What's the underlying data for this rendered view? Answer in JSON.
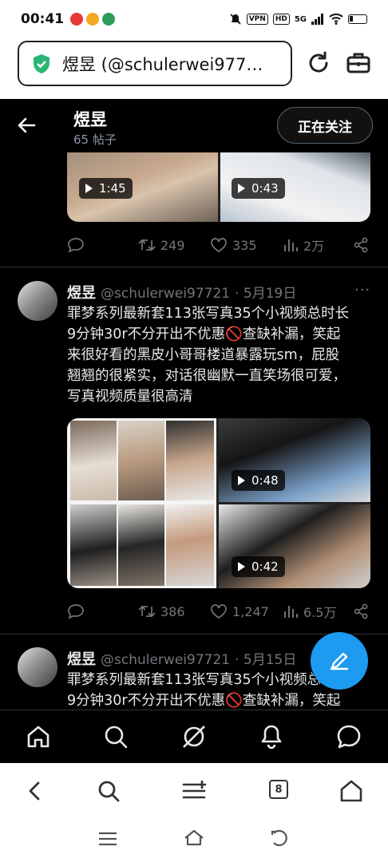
{
  "status_bar": {
    "time": "00:41",
    "net_labels": [
      "VPN",
      "HD",
      "5G"
    ]
  },
  "browser": {
    "url_text": "煜昱 (@schulerwei977…",
    "tab_count": "8"
  },
  "profile": {
    "name": "煜昱",
    "posts": "65 帖子",
    "follow_label": "正在关注"
  },
  "post0": {
    "videos": [
      "1:45",
      "0:43"
    ],
    "stats": {
      "retweets": "249",
      "likes": "335",
      "views": "2万"
    }
  },
  "post1": {
    "name": "煜昱",
    "handle": "@schulerwei97721",
    "date": "· 5月19日",
    "more": "···",
    "text_lines": [
      "罪梦系列最新套113张写真35个小视频总时长",
      "9分钟30r不分开出不优惠🚫查缺补漏，笑起",
      "来很好看的黑皮小哥哥楼道暴露玩sm，屁股",
      "翘翘的很紧实，对话很幽默一直笑场很可爱，",
      "写真视频质量很高清"
    ],
    "videos": [
      "0:48",
      "0:42"
    ],
    "stats": {
      "retweets": "386",
      "likes": "1,247",
      "views": "6.5万"
    }
  },
  "post2": {
    "name": "煜昱",
    "handle": "@schulerwei97721",
    "date": "· 5月15日",
    "text_lines": [
      "罪梦系列最新套113张写真35个小视频总时长",
      "9分钟30r不分开出不优惠🚫查缺补漏，笑起"
    ]
  },
  "colors": {
    "accent": "#1d9bf0",
    "background": "#000000",
    "muted": "#71767b",
    "verified": "#2bb673"
  },
  "icons": {
    "tabs": [
      "home-icon",
      "search-icon",
      "grok-icon",
      "notifications-icon",
      "messages-icon"
    ],
    "browser_nav": [
      "back-icon",
      "search-icon",
      "menu-icon",
      "tabs-icon",
      "home-icon"
    ]
  }
}
